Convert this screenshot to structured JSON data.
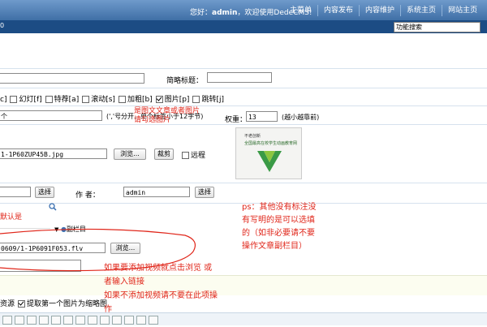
{
  "header": {
    "welcome_prefix": "您好：",
    "welcome_user": "admin",
    "welcome_suffix": "，欢迎使用DedeCMS!",
    "nav": [
      "主菜单",
      "内容发布",
      "内容维护",
      "系统主页",
      "网站主页"
    ],
    "sub_left": "0",
    "search_value": "功能搜索"
  },
  "form": {
    "short_title_label": "简略标题：",
    "attributes": {
      "a": "c]",
      "f": "幻灯[f]",
      "s": "特荐[a]",
      "s2": "滚动[s]",
      "b": "加粗[b]",
      "p": "图片[p]",
      "j": "跳转[j]"
    },
    "keywords_value": "个",
    "keywords_hint": "(','号分开，单个标签小于12字节)",
    "weight_label": "权重：",
    "weight_value": "13",
    "weight_hint": "(越小越靠前)",
    "litpic_value": "1-1P60ZUP45B.jpg",
    "browse_label": "浏览...",
    "crop_label": "裁剪",
    "remote_label": "远程",
    "source_select_label": "选择",
    "author_label": "作    者：",
    "author_value": "admin",
    "author_select_label": "选择",
    "default_text": "默认是",
    "subcolumn_label": "副栏目",
    "video_value": "0609/1-1P6091F053.flv",
    "video_browse_label": "浏览...",
    "download_remote_label": "资源",
    "first_pic_label": "提取第一个图片为缩略图"
  },
  "thumbnail": {
    "line1": "不老创新",
    "line2": "全国最高在校学生动画教育网"
  },
  "annotations": {
    "pic_hint_1": "是图文文章或者图片",
    "pic_hint_2": "请勾选图片",
    "ps_line1": "ps：其他没有标注没",
    "ps_line2": "有写明的是可以选填",
    "ps_line3": "的（如非必要请不要",
    "ps_line4": "操作文章副栏目）",
    "video_hint_1": "如果要添加视频就点击浏览 或",
    "video_hint_2": "者输入链接",
    "video_hint_3": "如果不添加视频请不要在此项操",
    "video_hint_4": "作"
  },
  "colors": {
    "header_blue": "#4f7eb4",
    "subbar_blue": "#1c4c84",
    "annotation_red": "#e0261a"
  }
}
